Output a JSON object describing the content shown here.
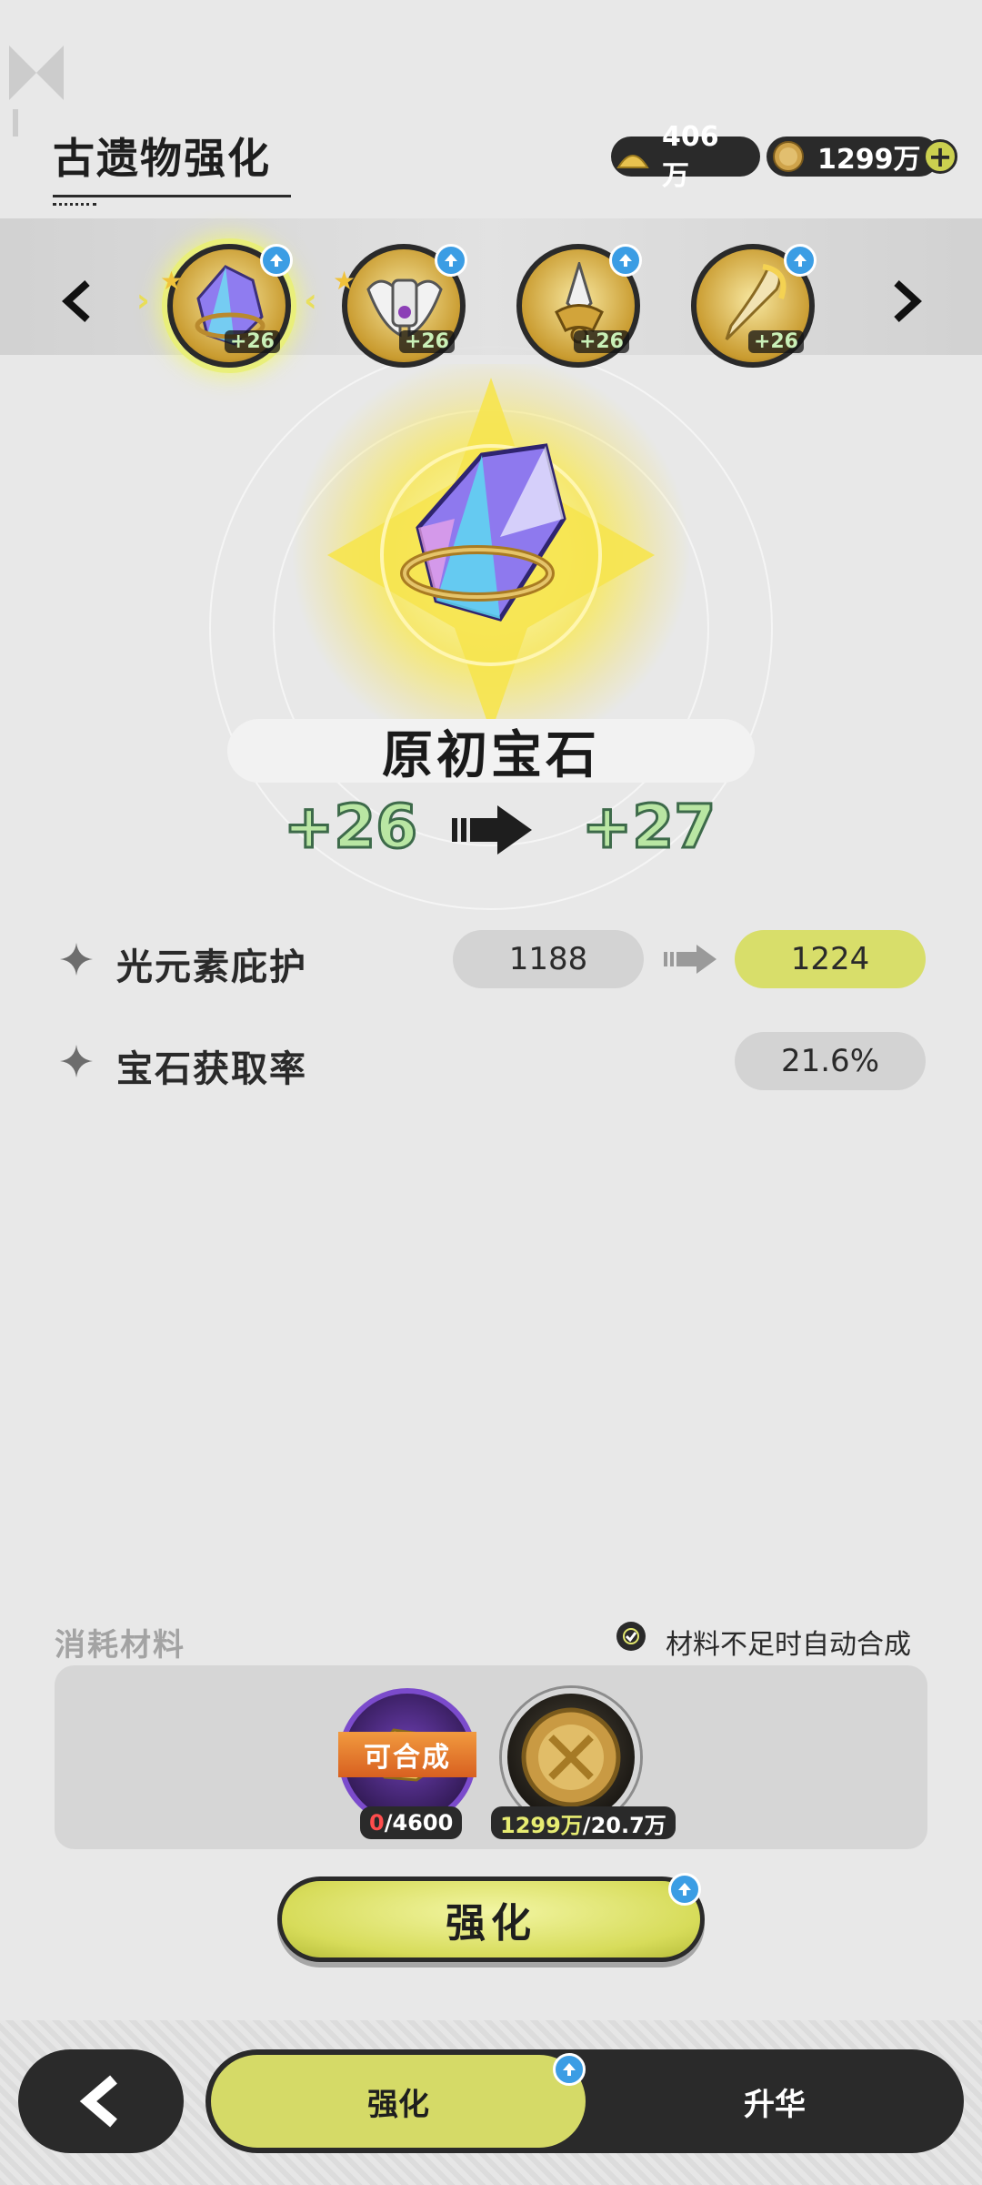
{
  "header": {
    "title": "古遗物强化",
    "resources": [
      {
        "name": "sand",
        "value": "406万",
        "icon": "sand-pile-icon"
      },
      {
        "name": "coin",
        "value": "1299万",
        "icon": "gold-coin-icon"
      }
    ],
    "add_icon": "plus-icon"
  },
  "relics": [
    {
      "level": "+26",
      "selected": true,
      "icon": "crystal-gem-icon"
    },
    {
      "level": "+26",
      "selected": false,
      "icon": "winged-crown-icon"
    },
    {
      "level": "+26",
      "selected": false,
      "icon": "spear-head-icon"
    },
    {
      "level": "+26",
      "selected": false,
      "icon": "golden-horn-icon"
    }
  ],
  "selected_relic": {
    "name": "原初宝石",
    "level_from": "+26",
    "level_to": "+27"
  },
  "stats": [
    {
      "label": "光元素庇护",
      "current": "1188",
      "next": "1224"
    },
    {
      "label": "宝石获取率",
      "current": "21.6%"
    }
  ],
  "materials": {
    "label": "消耗材料",
    "auto_synth_label": "材料不足时自动合成",
    "ore": {
      "craft_label": "可合成",
      "have": "0",
      "need": "/4600"
    },
    "coin": {
      "have": "1299万",
      "need": "/20.7万"
    }
  },
  "enhance_button": "强化",
  "tabs": {
    "active": "强化",
    "inactive": "升华"
  },
  "colors": {
    "accent": "#d5da67",
    "badge_blue": "#3b9de4",
    "level_green": "#b9e6a3"
  }
}
